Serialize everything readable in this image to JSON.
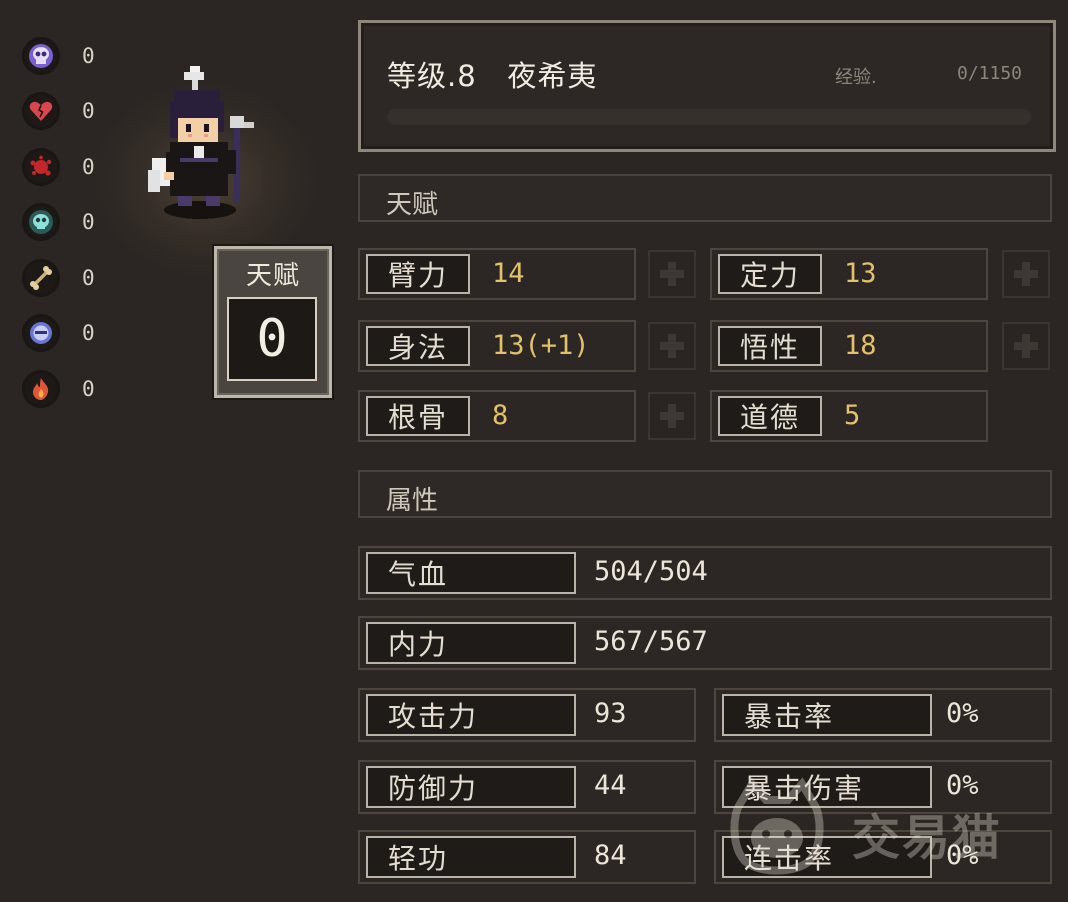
{
  "status_effects": [
    {
      "icon": "skull-icon",
      "color": "#7a5fd0",
      "count": "0"
    },
    {
      "icon": "broken-heart-icon",
      "color": "#d8464f",
      "count": "0"
    },
    {
      "icon": "blood-splat-icon",
      "color": "#c3262b",
      "count": "0"
    },
    {
      "icon": "poison-skull-icon",
      "color": "#57b7b0",
      "count": "0"
    },
    {
      "icon": "bone-icon",
      "color": "#c9b07a",
      "count": "0"
    },
    {
      "icon": "frozen-face-icon",
      "color": "#6a74d2",
      "count": "0"
    },
    {
      "icon": "fire-icon",
      "color": "#e0563a",
      "count": "0"
    }
  ],
  "talent_badge": {
    "title": "天赋",
    "value": "0"
  },
  "header": {
    "level_name": "等级.8   夜希夷",
    "exp_label": "经验.",
    "exp_value": "0/1150",
    "exp_progress": 0
  },
  "sections": {
    "talent": "天赋",
    "attributes": "属性"
  },
  "stats": [
    {
      "label": "臂力",
      "value": "14"
    },
    {
      "label": "定力",
      "value": "13"
    },
    {
      "label": "身法",
      "value": "13(+1)"
    },
    {
      "label": "悟性",
      "value": "18"
    },
    {
      "label": "根骨",
      "value": "8"
    },
    {
      "label": "道德",
      "value": "5"
    }
  ],
  "attributes": {
    "hp": {
      "label": "气血",
      "value": "504/504"
    },
    "mp": {
      "label": "内力",
      "value": "567/567"
    },
    "attack": {
      "label": "攻击力",
      "value": "93"
    },
    "crit_rate": {
      "label": "暴击率",
      "value": "0%"
    },
    "defense": {
      "label": "防御力",
      "value": "44"
    },
    "crit_damage": {
      "label": "暴击伤害",
      "value": "0%"
    },
    "agility": {
      "label": "轻功",
      "value": "84"
    },
    "combo_rate": {
      "label": "连击率",
      "value": "0%"
    }
  },
  "watermark": {
    "text": "交易猫"
  },
  "colors": {
    "background": "#2b2623",
    "stat_value": "#e2c16b",
    "label_border": "#bab3a7"
  }
}
